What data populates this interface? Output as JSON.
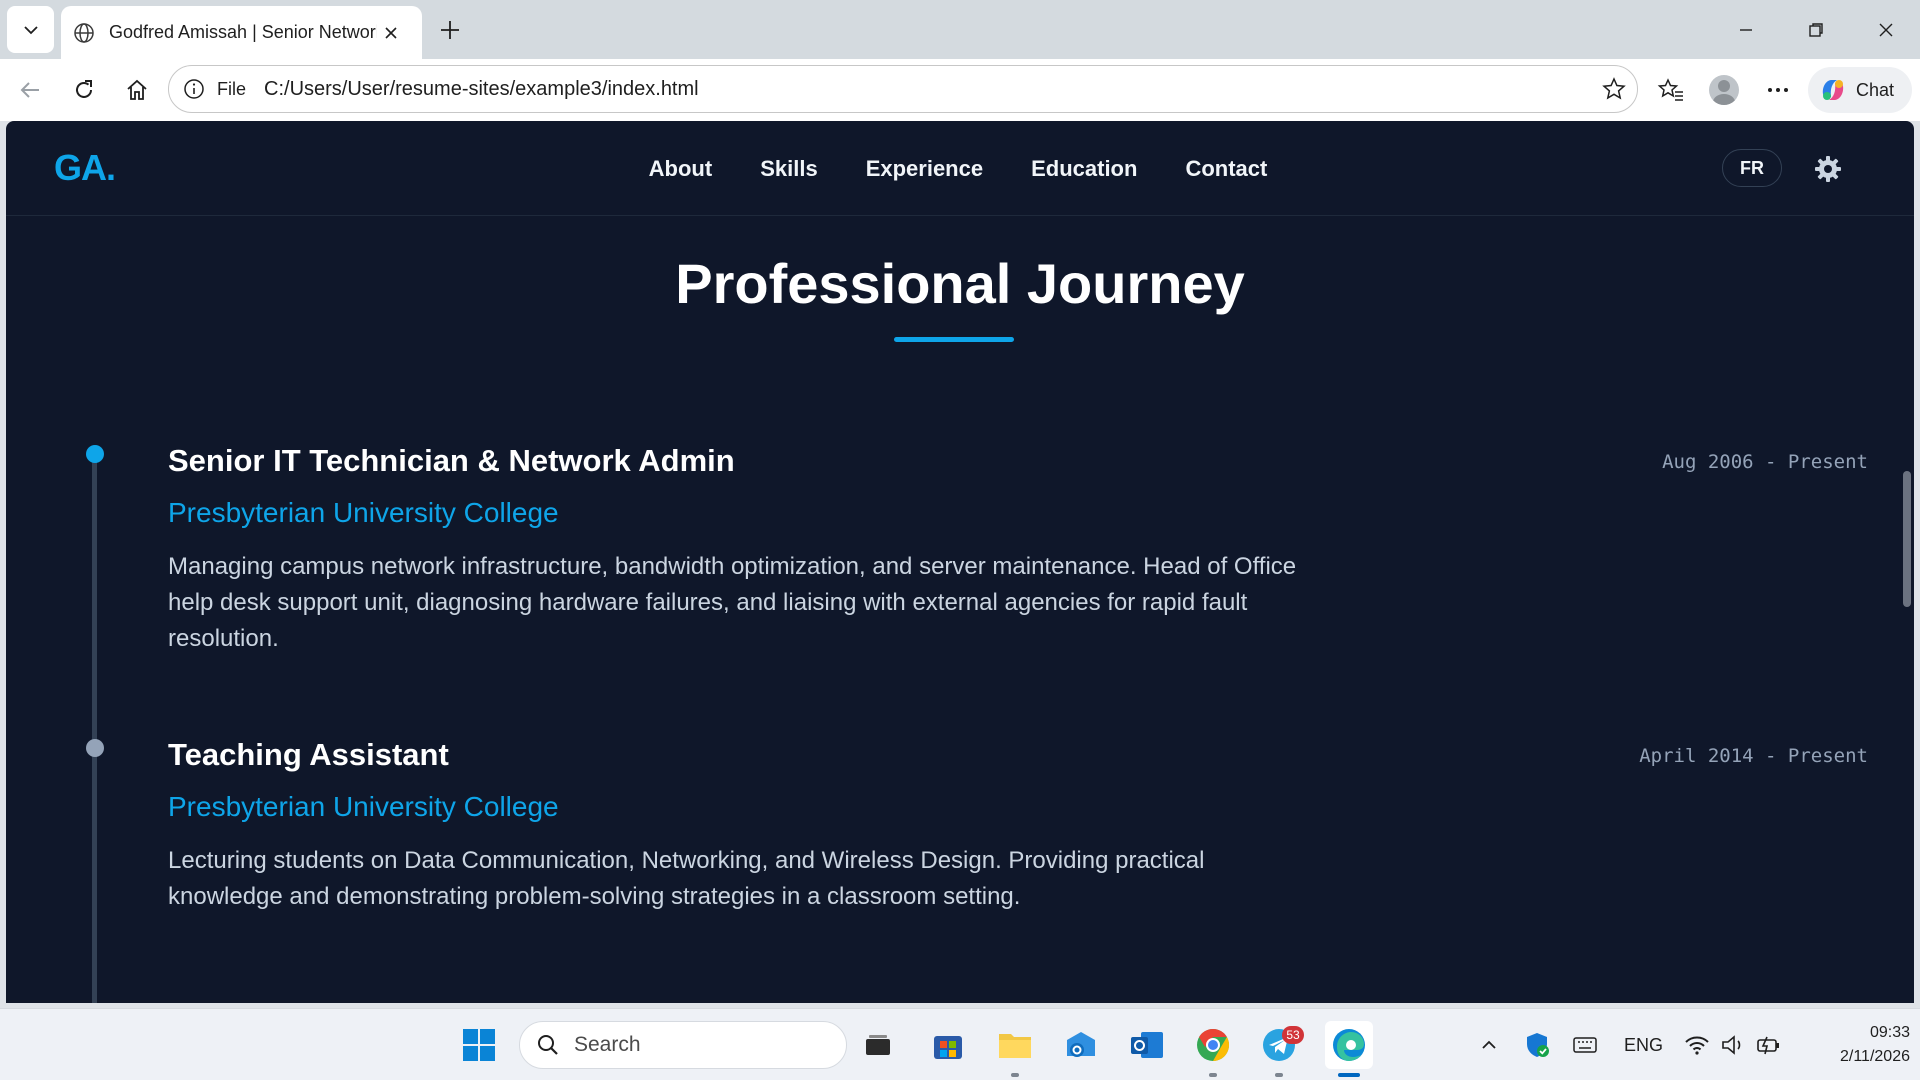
{
  "browser": {
    "tab_title": "Godfred Amissah | Senior Network Administrator",
    "address_prefix": "File",
    "url": "C:/Users/User/resume-sites/example3/index.html",
    "chat_label": "Chat"
  },
  "site": {
    "logo": "GA.",
    "nav": [
      "About",
      "Skills",
      "Experience",
      "Education",
      "Contact"
    ],
    "lang_button": "FR",
    "section_title": "Professional Journey",
    "accent_color": "#0ea5e9",
    "background_color": "#0f172a",
    "jobs": [
      {
        "title": "Senior IT Technician & Network Admin",
        "company": "Presbyterian University College",
        "date": "Aug 2006 - Present",
        "description": "Managing campus network infrastructure, bandwidth optimization, and server maintenance. Head of Office help desk support unit, diagnosing hardware failures, and liaising with external agencies for rapid fault resolution."
      },
      {
        "title": "Teaching Assistant",
        "company": "Presbyterian University College",
        "date": "April 2014 - Present",
        "description": "Lecturing students on Data Communication, Networking, and Wireless Design. Providing practical knowledge and demonstrating problem-solving strategies in a classroom setting."
      }
    ]
  },
  "taskbar": {
    "search_label": "Search",
    "telegram_badge": "53",
    "language": "ENG",
    "time": "09:33",
    "date": "2/11/2026"
  }
}
